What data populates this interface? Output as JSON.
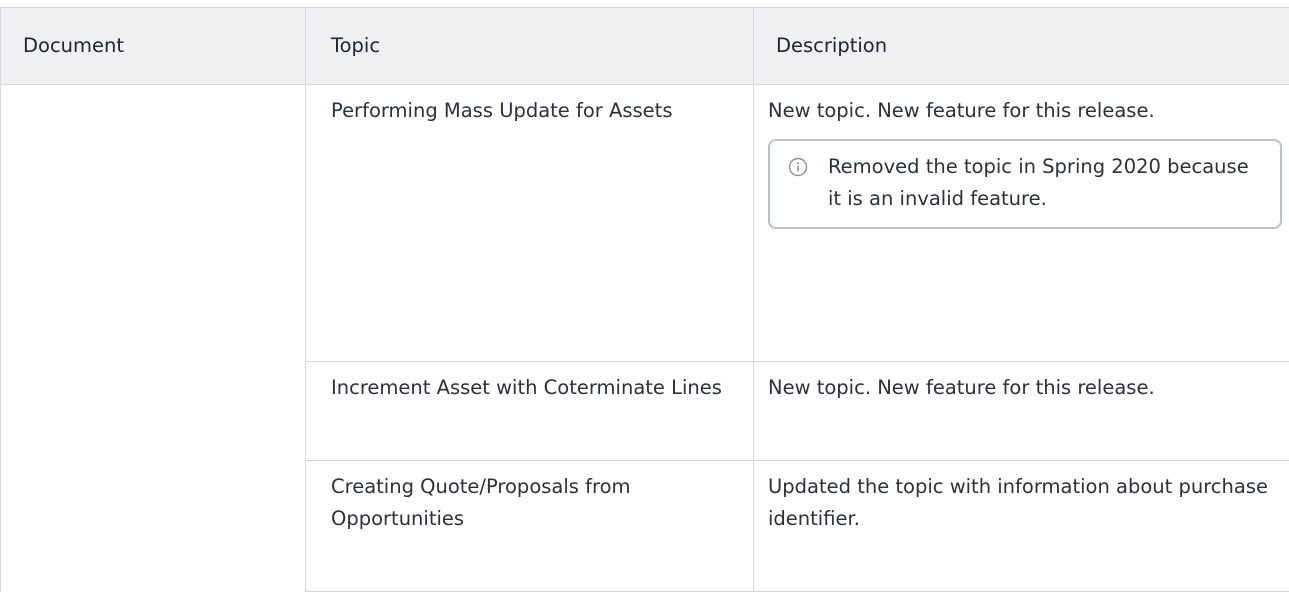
{
  "table": {
    "headers": {
      "document": "Document",
      "topic": "Topic",
      "description": "Description"
    },
    "rows": [
      {
        "topic": "Performing Mass Update for Assets",
        "description": "New topic. New feature for this release.",
        "note": {
          "icon": "info-icon",
          "text": "Removed the topic in Spring 2020 because it is an invalid feature."
        }
      },
      {
        "topic": "Increment Asset with Coterminate Lines",
        "description": "New topic. New feature for this release."
      },
      {
        "topic": "Creating Quote/Proposals from Opportunities",
        "description": "Updated the topic with information about purchase identifier."
      }
    ]
  }
}
